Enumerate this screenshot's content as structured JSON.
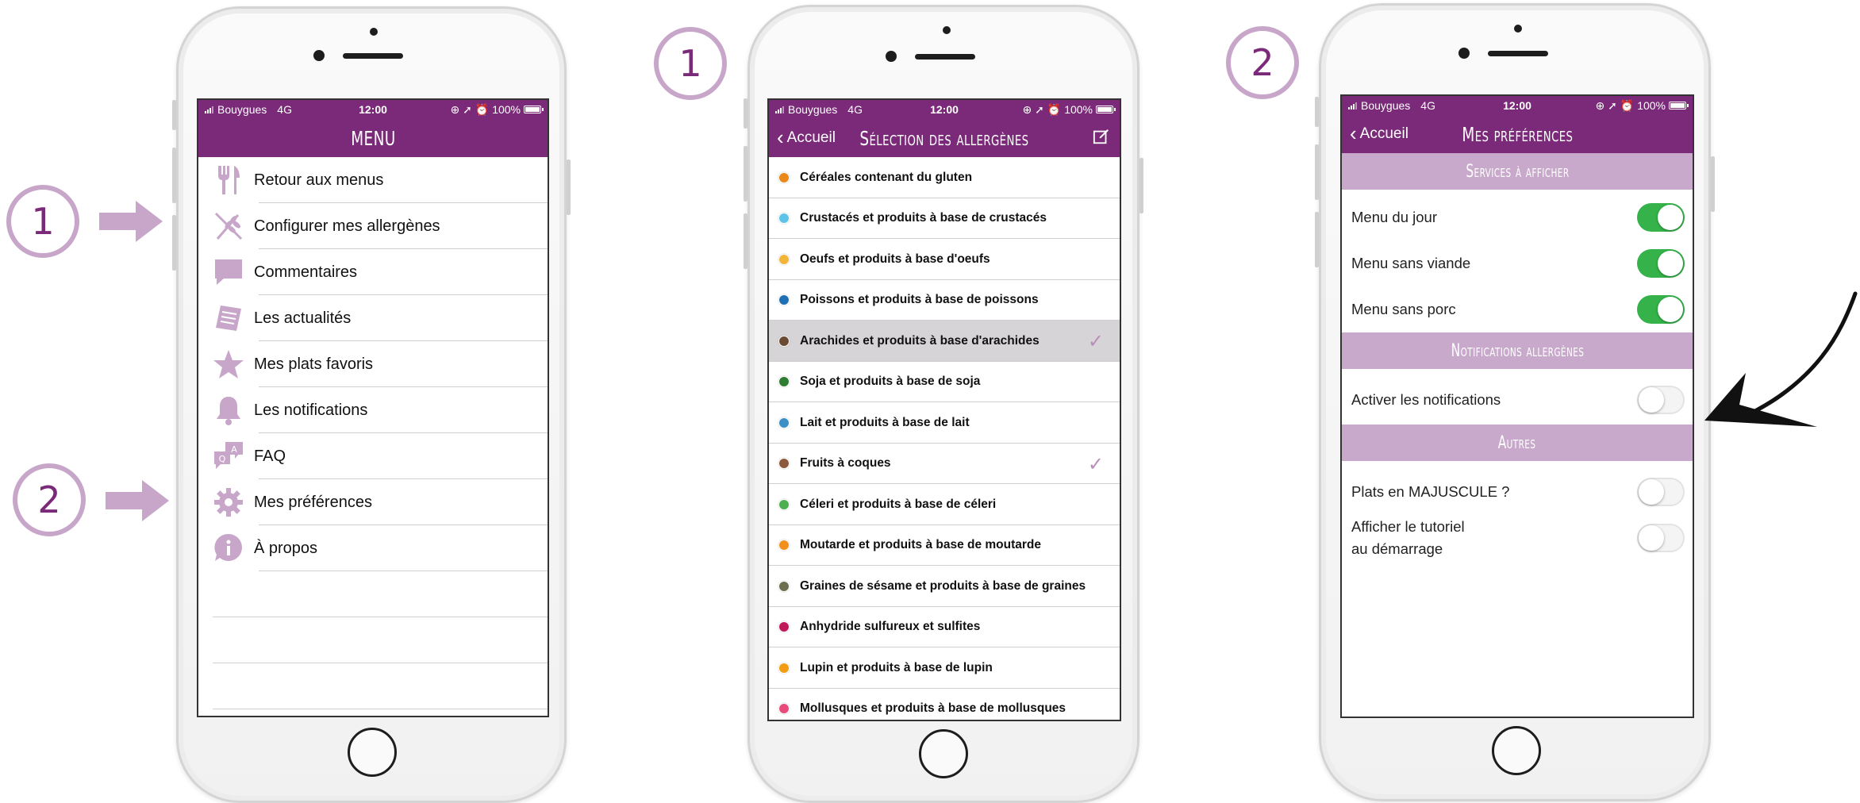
{
  "colors": {
    "brand": "#7a2a78",
    "accent_light": "#c7a6ca",
    "toggle_on": "#35b34a"
  },
  "callouts": {
    "one": "1",
    "two": "2"
  },
  "status_bar": {
    "carrier": "Bouygues",
    "network": "4G",
    "time": "12:00",
    "battery": "100%"
  },
  "menu_screen": {
    "title": "MENU",
    "items": [
      {
        "label": "Retour aux menus",
        "icon": "fork-knife-icon"
      },
      {
        "label": "Configurer mes allergènes",
        "icon": "wheat-crossed-icon"
      },
      {
        "label": "Commentaires",
        "icon": "speech-bubble-icon"
      },
      {
        "label": "Les actualités",
        "icon": "newspaper-icon"
      },
      {
        "label": "Mes plats favoris",
        "icon": "star-icon"
      },
      {
        "label": "Les notifications",
        "icon": "bell-icon"
      },
      {
        "label": "FAQ",
        "icon": "faq-bubbles-icon"
      },
      {
        "label": "Mes préférences",
        "icon": "gear-icon"
      },
      {
        "label": "À propos",
        "icon": "info-icon"
      }
    ]
  },
  "allergen_screen": {
    "back": "Accueil",
    "title": "Sélection des allergènes",
    "items": [
      {
        "label": "Céréales contenant du gluten",
        "color": "#e8891a",
        "selected": false,
        "checked": false
      },
      {
        "label": "Crustacés et produits à base de crustacés",
        "color": "#5ec3e8",
        "selected": false,
        "checked": false
      },
      {
        "label": "Oeufs et produits à base d'oeufs",
        "color": "#f2b53a",
        "selected": false,
        "checked": false
      },
      {
        "label": "Poissons et produits à base de poissons",
        "color": "#1f6fb5",
        "selected": false,
        "checked": false
      },
      {
        "label": "Arachides et produits à base d'arachides",
        "color": "#6b4a34",
        "selected": true,
        "checked": true
      },
      {
        "label": "Soja et produits à base de soja",
        "color": "#2e7d32",
        "selected": false,
        "checked": false
      },
      {
        "label": "Lait et produits à base de lait",
        "color": "#3a8fc7",
        "selected": false,
        "checked": false
      },
      {
        "label": "Fruits à coques",
        "color": "#8b5a3c",
        "selected": false,
        "checked": true
      },
      {
        "label": "Céleri et produits à base de céleri",
        "color": "#4caf50",
        "selected": false,
        "checked": false
      },
      {
        "label": "Moutarde et produits à base de moutarde",
        "color": "#f0901e",
        "selected": false,
        "checked": false
      },
      {
        "label": "Graines de sésame et produits à base de graines",
        "color": "#6d6d4f",
        "selected": false,
        "checked": false
      },
      {
        "label": "Anhydride sulfureux et sulfites",
        "color": "#c2185b",
        "selected": false,
        "checked": false
      },
      {
        "label": "Lupin et produits à base de lupin",
        "color": "#f39c12",
        "selected": false,
        "checked": false
      },
      {
        "label": "Mollusques et produits à base de mollusques",
        "color": "#e84a7a",
        "selected": false,
        "checked": false
      }
    ]
  },
  "prefs_screen": {
    "back": "Accueil",
    "title": "Mes préférences",
    "sections": [
      {
        "header": "Services à afficher",
        "rows": [
          {
            "label": "Menu du jour",
            "on": true
          },
          {
            "label": "Menu sans viande",
            "on": true
          },
          {
            "label": "Menu sans porc",
            "on": true
          }
        ]
      },
      {
        "header": "Notifications allergènes",
        "rows": [
          {
            "label": "Activer les notifications",
            "on": false
          }
        ]
      },
      {
        "header": "Autres",
        "rows": [
          {
            "label": "Plats en MAJUSCULE ?",
            "on": false
          },
          {
            "label": "Afficher le tutoriel\nau démarrage",
            "on": false
          }
        ]
      }
    ]
  }
}
